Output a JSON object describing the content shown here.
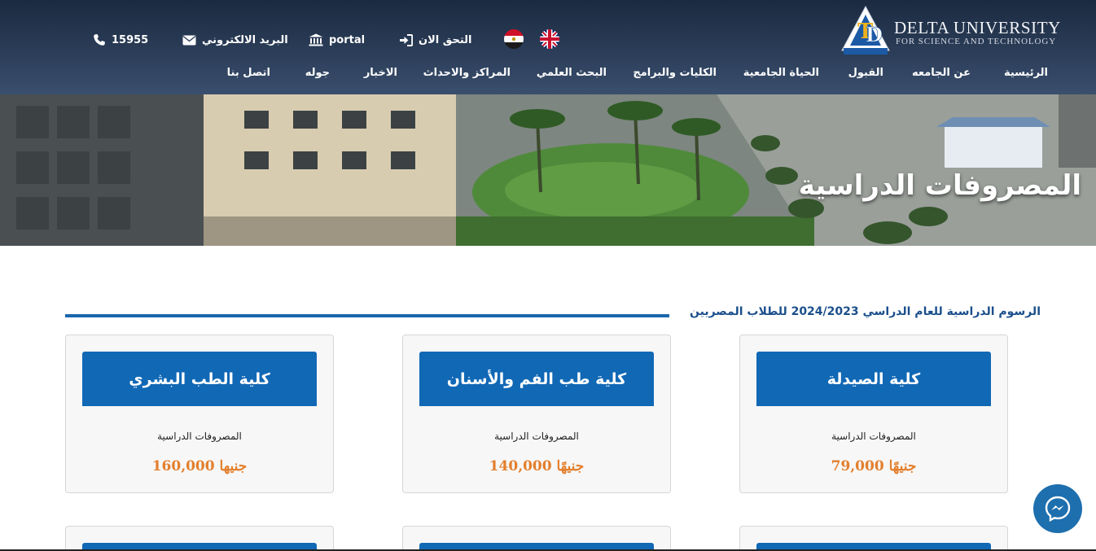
{
  "header": {
    "logo": {
      "line1": "DELTA UNIVERSITY",
      "line2": "FOR SCIENCE AND TECHNOLOGY",
      "mark_caption": "DELTA UNIVERSITY"
    },
    "topbar": {
      "phone": "15955",
      "email_label": "البريد الالكتروني",
      "portal_label": "portal",
      "verify_label": "التحق الان"
    },
    "languages": [
      "en",
      "ar"
    ],
    "nav": [
      {
        "label": "الرئيسية"
      },
      {
        "label": "عن الجامعه"
      },
      {
        "label": "القبول"
      },
      {
        "label": "الحياة الجامعية"
      },
      {
        "label": "الكليات والبرامج"
      },
      {
        "label": "البحث العلمي"
      },
      {
        "label": "المراكز والاحداث"
      },
      {
        "label": "الاخبار"
      },
      {
        "label": "جوله"
      },
      {
        "label": "اتصل بنا"
      }
    ]
  },
  "banner": {
    "title": "المصروفات الدراسية"
  },
  "content": {
    "heading": "الرسوم الدراسية للعام الدراسي 2024/2023 للطلاب المصريين",
    "cards": [
      {
        "title": "كلية الصيدلة",
        "label": "المصروفات الدراسية",
        "price": "جنيهًا 79,000"
      },
      {
        "title": "كلية طب الفم والأسنان",
        "label": "المصروفات الدراسية",
        "price": "جنيهًا 140,000"
      },
      {
        "title": "كلية الطب البشري",
        "label": "المصروفات الدراسية",
        "price": "جنيها 160,000"
      }
    ]
  },
  "colors": {
    "header_bg": "#1b2a40",
    "card_header": "#1168b5",
    "price": "#e37f2d",
    "heading": "#1b4f8c",
    "messenger": "#1e6fae"
  },
  "icons": [
    "phone-icon",
    "envelope-icon",
    "bank-icon",
    "sign-in-icon",
    "messenger-icon"
  ]
}
